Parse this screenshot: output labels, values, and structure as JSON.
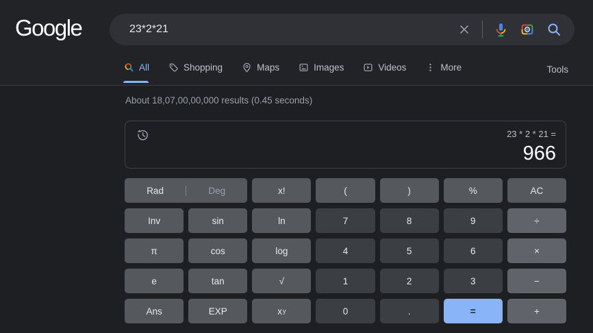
{
  "header": {
    "logo_text": "Google",
    "search_query": "23*2*21"
  },
  "tabs": {
    "all": "All",
    "shopping": "Shopping",
    "maps": "Maps",
    "images": "Images",
    "videos": "Videos",
    "more": "More",
    "tools": "Tools"
  },
  "stats_text": "About 18,07,00,00,000 results (0.45 seconds)",
  "calculator": {
    "expression": "23 * 2 * 21 =",
    "result": "966",
    "keypad": {
      "rad": "Rad",
      "deg": "Deg",
      "factorial": "x!",
      "open_paren": "(",
      "close_paren": ")",
      "percent": "%",
      "clear": "AC",
      "inv": "Inv",
      "sin": "sin",
      "ln": "ln",
      "seven": "7",
      "eight": "8",
      "nine": "9",
      "divide": "÷",
      "pi": "π",
      "cos": "cos",
      "log": "log",
      "four": "4",
      "five": "5",
      "six": "6",
      "multiply": "×",
      "e": "e",
      "tan": "tan",
      "sqrt": "√",
      "one": "1",
      "two": "2",
      "three": "3",
      "minus": "−",
      "ans": "Ans",
      "exp": "EXP",
      "pow_base": "x",
      "pow_exp": "y",
      "zero": "0",
      "decimal": ".",
      "equals": "=",
      "plus": "+"
    }
  },
  "colors": {
    "accent_blue": "#8ab4f8",
    "equals_bg": "#8ab4f8",
    "google_blue": "#4285f4",
    "google_red": "#ea4335",
    "google_yellow": "#fbbc05",
    "google_green": "#34a853",
    "page_bg": "#1d1f23",
    "header_bg": "#212326",
    "key_fn_bg": "#55585d",
    "key_digit_bg": "#3b3e42",
    "key_op_bg": "#60646a"
  }
}
